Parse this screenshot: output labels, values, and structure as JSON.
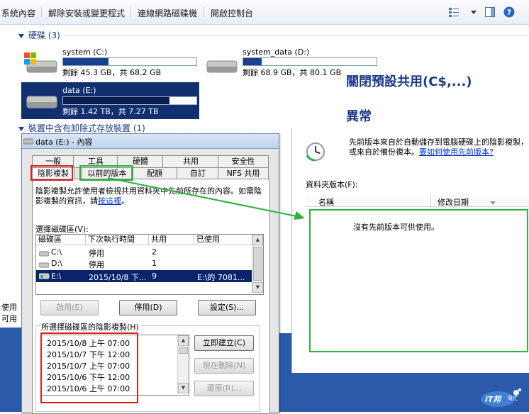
{
  "toolbar": {
    "items": [
      "系統內容",
      "解除安裝或變更程式",
      "連線網路磁碟機",
      "開啟控制台"
    ]
  },
  "hard_disks": {
    "header": "硬碟 (3)",
    "drives": [
      {
        "name": "system (C:)",
        "free_text": "剩餘 45.3 GB，共 68.2 GB",
        "used_fraction": 0.34
      },
      {
        "name": "system_data (D:)",
        "free_text": "剩餘 68.9 GB，共 80.1 GB",
        "used_fraction": 0.14
      },
      {
        "name": "data (E:)",
        "free_text": "剩餘 1.42 TB，共 7.27 TB",
        "used_fraction": 0.8
      }
    ]
  },
  "removable": {
    "header": "裝置中含有卸除式存放裝置 (1)"
  },
  "annotations": {
    "line1": "關閉預設共用(C$,...)",
    "line2": "異常"
  },
  "dialog": {
    "title": "data (E:) - 內容",
    "tabs_row1": [
      "一般",
      "工具",
      "硬體",
      "共用",
      "安全性"
    ],
    "tabs_row2": [
      "陰影複製",
      "以前的版本",
      "配額",
      "自訂",
      "NFS 共用"
    ],
    "description": "陰影複製允許使用者檢視共用資料夾中先前所存在的內容。如需陰影複製的資訊，請",
    "description_link": "按這裡",
    "description_end": "。",
    "select_volume_label": "選擇磁碟區(V):",
    "columns": [
      "磁碟區",
      "下次執行時間",
      "共用",
      "已使用"
    ],
    "rows": [
      {
        "vol": "C:\\",
        "next": "停用",
        "shares": "2",
        "used": ""
      },
      {
        "vol": "D:\\",
        "next": "停用",
        "shares": "1",
        "used": ""
      },
      {
        "vol": "E:\\",
        "next": "2015/10/8 下...",
        "shares": "9",
        "used": "E:\\的 7081..."
      }
    ],
    "buttons": {
      "enable": "啟用(E)",
      "disable": "停用(D)",
      "settings": "設定(S)..."
    },
    "group_label": "所選擇磁碟區的陰影複製(H)",
    "snapshots": [
      "2015/10/8 上午 07:00",
      "2015/10/7 下午 12:00",
      "2015/10/7 上午 07:00",
      "2015/10/6 下午 12:00",
      "2015/10/6 上午 07:00"
    ],
    "side_buttons": {
      "create": "立即建立(C)",
      "delete": "現在刪除(N)",
      "revert": "還原(R)..."
    }
  },
  "right_window": {
    "info": "先前版本來自於自動儲存到電腦硬碟上的陰影複製，或來自於備份複本。",
    "link": "要如何使用先前版本?",
    "folder_versions_label": "資料夾版本(F):",
    "columns": [
      "名稱",
      "修改日期"
    ],
    "empty_message": "沒有先前版本可供使用。"
  },
  "left_status": {
    "line1": "使用",
    "line2": "可用"
  },
  "logo": {
    "text": "iT邦",
    "sub": "幫忙"
  },
  "colors": {
    "accent": "#1b3f8f",
    "red_box": "#e02020",
    "green_box": "#2bb33a",
    "selection": "#0a246a"
  }
}
